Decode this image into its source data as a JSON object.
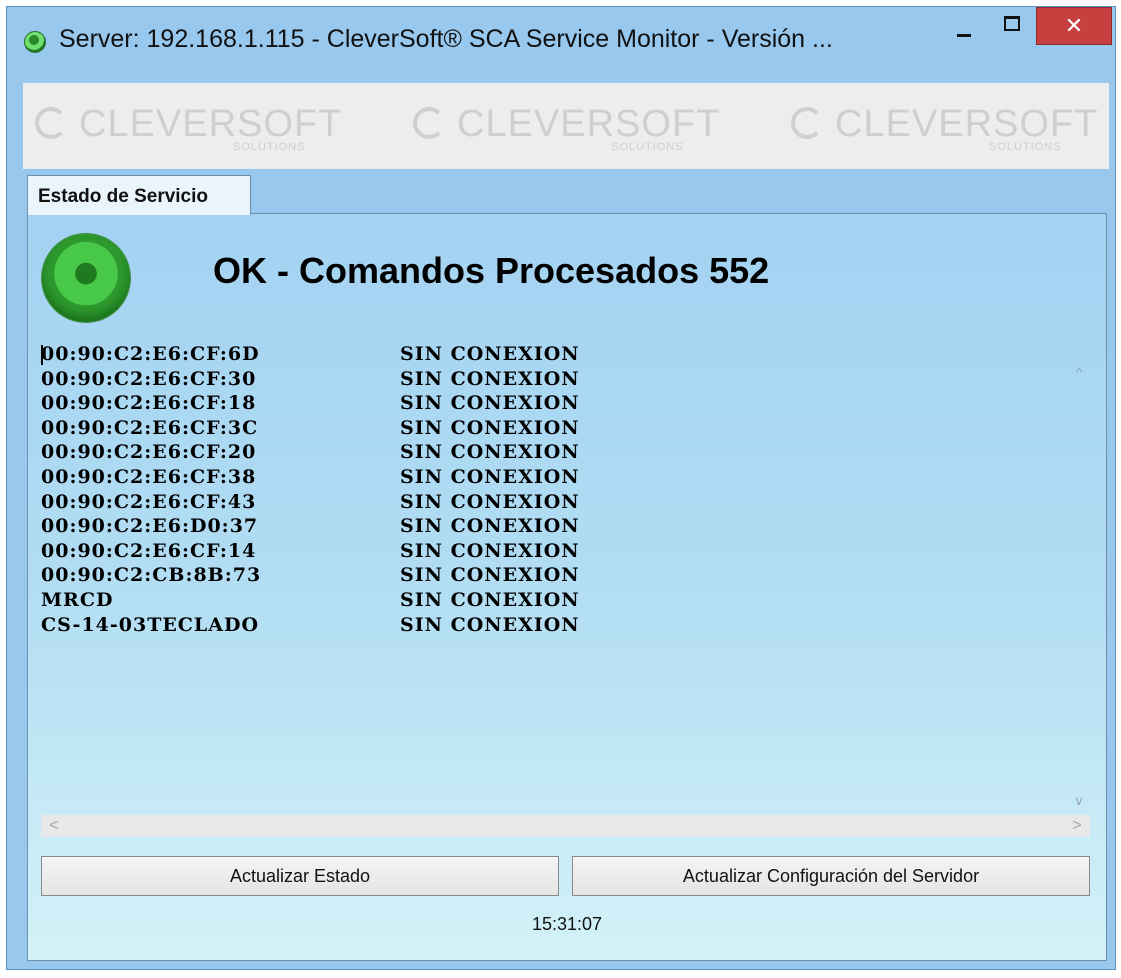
{
  "window": {
    "title": "Server: 192.168.1.115 - CleverSoft® SCA Service Monitor  -  Versión ...",
    "minimize_icon": "minimize-icon",
    "maximize_icon": "maximize-icon",
    "close_icon": "close-icon",
    "close_glyph": "✕",
    "close_color": "#c74040"
  },
  "banner": {
    "logos": [
      {
        "name": "CLEVERSOFT",
        "sub": "SOLUTIONS"
      },
      {
        "name": "CLEVERSOFT",
        "sub": "SOLUTIONS"
      },
      {
        "name": "CLEVERSOFT",
        "sub": "SOLUTIONS"
      }
    ]
  },
  "tabs": [
    {
      "label": "Estado de Servicio",
      "active": true
    }
  ],
  "status": {
    "text": "OK - Comandos Procesados 552",
    "led_color": "#2e9a2e"
  },
  "devices": [
    {
      "id": "00:90:C2:E6:CF:6D",
      "state": "SIN CONEXION"
    },
    {
      "id": "00:90:C2:E6:CF:30",
      "state": "SIN CONEXION"
    },
    {
      "id": "00:90:C2:E6:CF:18",
      "state": "SIN CONEXION"
    },
    {
      "id": "00:90:C2:E6:CF:3C",
      "state": "SIN CONEXION"
    },
    {
      "id": "00:90:C2:E6:CF:20",
      "state": "SIN CONEXION"
    },
    {
      "id": "00:90:C2:E6:CF:38",
      "state": "SIN CONEXION"
    },
    {
      "id": "00:90:C2:E6:CF:43",
      "state": "SIN CONEXION"
    },
    {
      "id": "00:90:C2:E6:D0:37",
      "state": "SIN CONEXION"
    },
    {
      "id": "00:90:C2:E6:CF:14",
      "state": "SIN CONEXION"
    },
    {
      "id": "00:90:C2:CB:8B:73",
      "state": "SIN CONEXION"
    },
    {
      "id": "MRCD",
      "state": "SIN CONEXION"
    },
    {
      "id": "CS-14-03TECLADO",
      "state": "SIN CONEXION"
    }
  ],
  "scrollbars": {
    "up_glyph": "^",
    "down_glyph": "v",
    "left_glyph": "<",
    "right_glyph": ">"
  },
  "buttons": {
    "refresh_label": "Actualizar Estado",
    "config_label": "Actualizar Configuración del Servidor"
  },
  "clock": "15:31:07"
}
